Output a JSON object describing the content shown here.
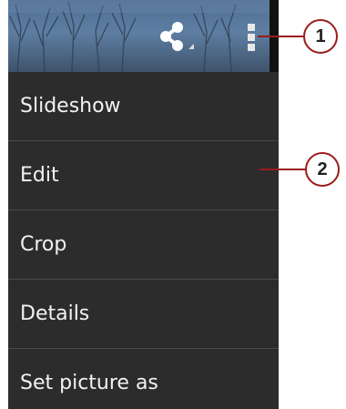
{
  "menu": {
    "items": [
      {
        "label": "Slideshow"
      },
      {
        "label": "Edit"
      },
      {
        "label": "Crop"
      },
      {
        "label": "Details"
      },
      {
        "label": "Set picture as"
      }
    ]
  },
  "callouts": [
    {
      "number": "1"
    },
    {
      "number": "2"
    }
  ],
  "icons": {
    "share": "share-icon",
    "overflow": "overflow-menu-icon"
  },
  "colors": {
    "menu_background": "#2c2c2c",
    "menu_text": "#f2f2f2",
    "divider": "#4a4a4a",
    "callout_accent": "#9b1c1c"
  }
}
